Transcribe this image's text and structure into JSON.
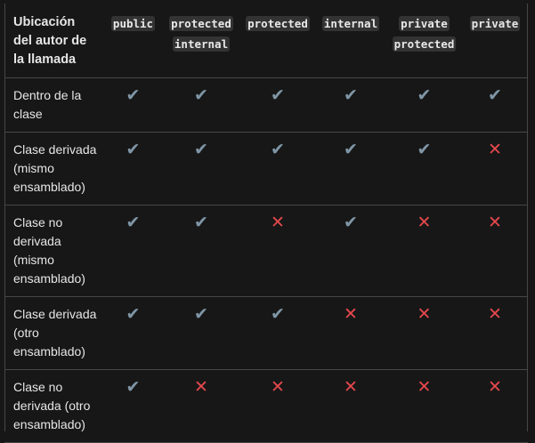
{
  "table": {
    "corner_header": "Ubicación del autor de la llamada",
    "columns": [
      [
        "public"
      ],
      [
        "protected",
        "internal"
      ],
      [
        "protected"
      ],
      [
        "internal"
      ],
      [
        "private",
        "protected"
      ],
      [
        "private"
      ]
    ],
    "rows": [
      {
        "label": "Dentro de la clase",
        "marks": [
          "✔",
          "✔",
          "✔",
          "✔",
          "✔",
          "✔"
        ]
      },
      {
        "label": "Clase derivada (mismo ensamblado)",
        "marks": [
          "✔",
          "✔",
          "✔",
          "✔",
          "✔",
          "✕"
        ]
      },
      {
        "label": "Clase no derivada (mismo ensamblado)",
        "marks": [
          "✔",
          "✔",
          "✕",
          "✔",
          "✕",
          "✕"
        ]
      },
      {
        "label": "Clase derivada (otro ensamblado)",
        "marks": [
          "✔",
          "✔",
          "✔",
          "✕",
          "✕",
          "✕"
        ]
      },
      {
        "label": "Clase no derivada (otro ensamblado)",
        "marks": [
          "✔",
          "✕",
          "✕",
          "✕",
          "✕",
          "✕"
        ]
      }
    ]
  },
  "colors": {
    "background": "#171717",
    "check": "#7f96a6",
    "cross": "#e5484d",
    "border": "#474747"
  }
}
